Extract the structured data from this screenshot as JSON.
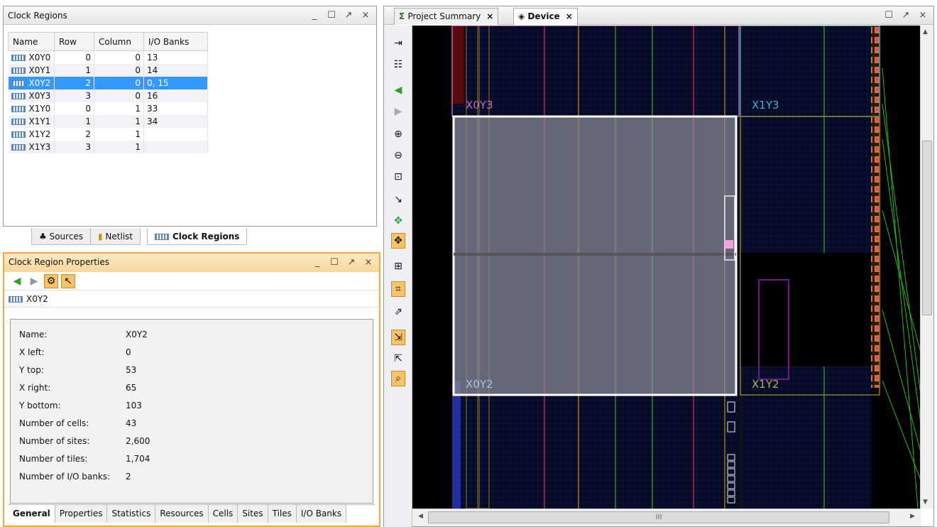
{
  "clock_regions": {
    "title": "Clock Regions",
    "columns": [
      "Name",
      "Row",
      "Column",
      "I/O Banks"
    ],
    "rows": [
      {
        "name": "X0Y0",
        "row": "0",
        "column": "0",
        "banks": "13"
      },
      {
        "name": "X0Y1",
        "row": "1",
        "column": "0",
        "banks": "14"
      },
      {
        "name": "X0Y2",
        "row": "2",
        "column": "0",
        "banks": "0, 15"
      },
      {
        "name": "X0Y3",
        "row": "3",
        "column": "0",
        "banks": "16"
      },
      {
        "name": "X1Y0",
        "row": "0",
        "column": "1",
        "banks": "33"
      },
      {
        "name": "X1Y1",
        "row": "1",
        "column": "1",
        "banks": "34"
      },
      {
        "name": "X1Y2",
        "row": "2",
        "column": "1",
        "banks": ""
      },
      {
        "name": "X1Y3",
        "row": "3",
        "column": "1",
        "banks": ""
      }
    ],
    "selected": "X0Y2"
  },
  "left_tabs": {
    "sources": "Sources",
    "netlist": "Netlist",
    "clock_regions": "Clock Regions"
  },
  "props": {
    "title": "Clock Region Properties",
    "subject": "X0Y2",
    "fields": [
      {
        "k": "Name:",
        "v": "X0Y2"
      },
      {
        "k": "X left:",
        "v": "0"
      },
      {
        "k": "Y top:",
        "v": "53"
      },
      {
        "k": "X right:",
        "v": "65"
      },
      {
        "k": "Y bottom:",
        "v": "103"
      },
      {
        "k": "Number of cells:",
        "v": "43"
      },
      {
        "k": "Number of sites:",
        "v": "2,600"
      },
      {
        "k": "Number of tiles:",
        "v": "1,704"
      },
      {
        "k": "Number of I/O banks:",
        "v": "2"
      }
    ],
    "tabs": [
      "General",
      "Properties",
      "Statistics",
      "Resources",
      "Cells",
      "Sites",
      "Tiles",
      "I/O Banks"
    ]
  },
  "device": {
    "tabs": {
      "summary": "Project Summary",
      "device": "Device"
    },
    "regions": {
      "x0y3": "X0Y3",
      "x1y3": "X1Y3",
      "x0y2": "X0Y2",
      "x1y2": "X1Y2"
    },
    "hscroll_mark": "III"
  },
  "colors": {
    "selection": "#3399ff",
    "accent": "#f0a840",
    "canvas": "#000000"
  }
}
